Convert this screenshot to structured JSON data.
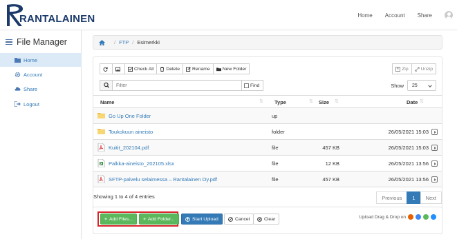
{
  "brand": {
    "name": "RANTALAINEN"
  },
  "topnav": {
    "home": "Home",
    "account": "Account",
    "share": "Share"
  },
  "sidebar": {
    "title": "File Manager",
    "items": [
      {
        "label": "Home",
        "icon": "folder-icon",
        "active": true
      },
      {
        "label": "Account",
        "icon": "gear-icon"
      },
      {
        "label": "Share",
        "icon": "cloud-icon"
      },
      {
        "label": "Logout",
        "icon": "logout-icon"
      }
    ]
  },
  "breadcrumb": {
    "items": [
      "FTP",
      "Esimerkki"
    ]
  },
  "toolbar": {
    "check_all": "Check All",
    "delete": "Delete",
    "rename": "Rename",
    "new_folder": "New Folder",
    "zip": "Zip",
    "unzip": "Unzip"
  },
  "filter": {
    "placeholder": "Filter",
    "find": "Find"
  },
  "show": {
    "label": "Show",
    "value": "25"
  },
  "table": {
    "headers": {
      "name": "Name",
      "type": "Type",
      "size": "Size",
      "date": "Date"
    },
    "rows": [
      {
        "name": "Go Up One Folder",
        "type": "up",
        "size": "",
        "date": "",
        "icon": "folder-up-icon"
      },
      {
        "name": "Toukokuun aineisto",
        "type": "folder",
        "size": "",
        "date": "26/05/2021 15:03",
        "icon": "folder-icon"
      },
      {
        "name": "Kuitit_202104.pdf",
        "type": "file",
        "size": "457 KB",
        "date": "26/05/2021 15:03",
        "icon": "pdf-icon"
      },
      {
        "name": "Palkka-aineisto_202105.xlsx",
        "type": "file",
        "size": "12 KB",
        "date": "26/05/2021 13:56",
        "icon": "excel-icon"
      },
      {
        "name": "SFTP-palvelu selaimessa – Rantalainen Oy.pdf",
        "type": "file",
        "size": "457 KB",
        "date": "26/05/2021 13:56",
        "icon": "pdf-icon"
      }
    ]
  },
  "entries": "Showing 1 to 4 of 4 entries",
  "pager": {
    "previous": "Previous",
    "page": "1",
    "next": "Next"
  },
  "upload": {
    "add_files": "Add Files...",
    "add_folder": "Add Folder...",
    "start": "Start Upload",
    "cancel": "Cancel",
    "clear": "Clear",
    "dnd": "Upload Drag & Drop on"
  },
  "colors": {
    "accent": "#337ab7",
    "success": "#5cb85c",
    "highlight": "#d9232a",
    "brand": "#1b3a6b"
  }
}
